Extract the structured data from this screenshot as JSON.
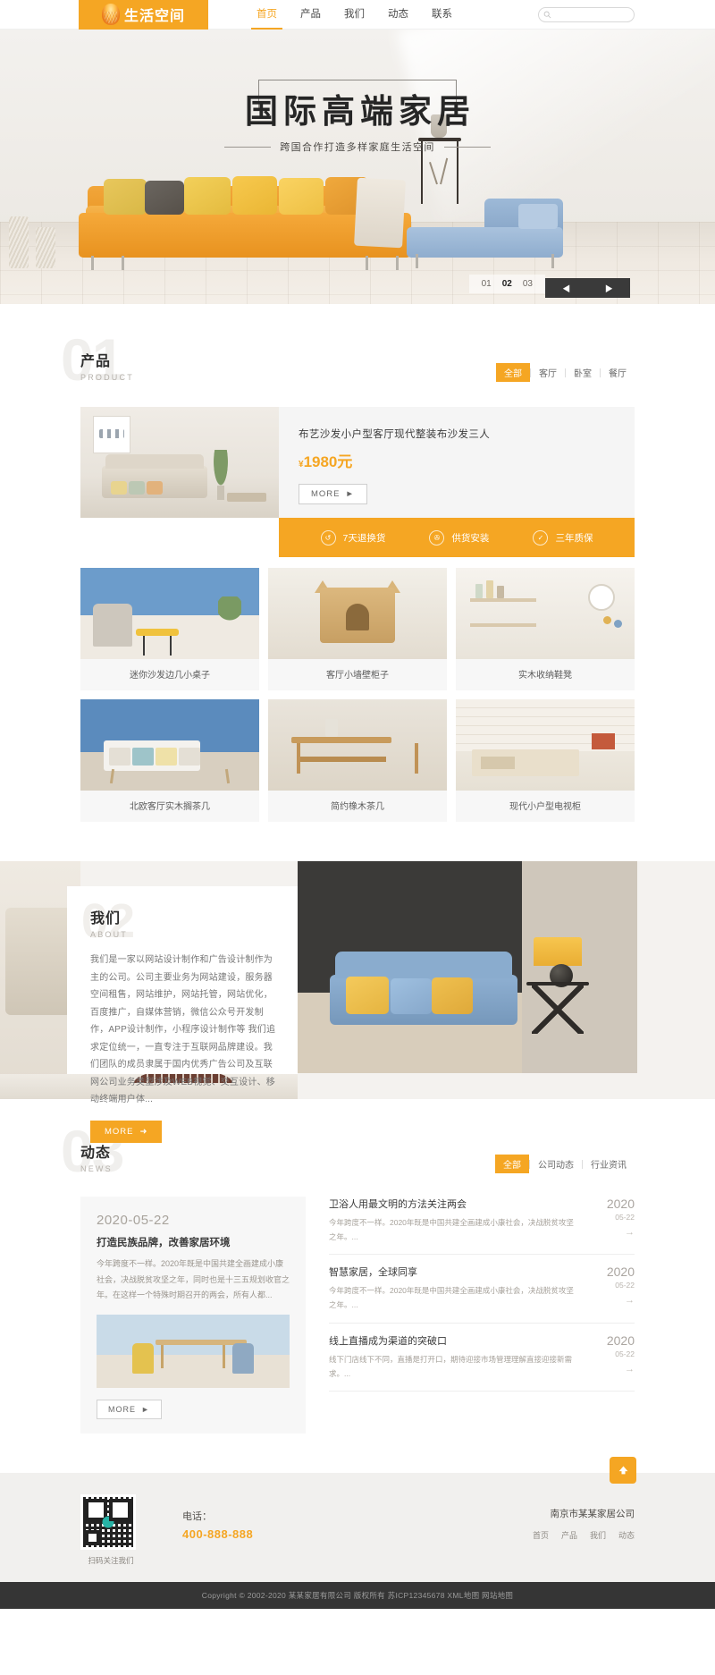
{
  "header": {
    "logo_text": "生活空间",
    "nav": [
      {
        "label": "首页",
        "active": true
      },
      {
        "label": "产品",
        "active": false
      },
      {
        "label": "我们",
        "active": false
      },
      {
        "label": "动态",
        "active": false
      },
      {
        "label": "联系",
        "active": false
      }
    ],
    "search_placeholder": ""
  },
  "hero": {
    "title": "国际高端家居",
    "subtitle": "跨国合作打造多样家庭生活空间",
    "slides": [
      "01",
      "02",
      "03"
    ],
    "active_slide": "02",
    "prev_label": "◀",
    "next_label": "▶"
  },
  "product": {
    "number": "01",
    "title_cn": "产品",
    "title_en": "PRODUCT",
    "filters": [
      {
        "label": "全部",
        "active": true
      },
      {
        "label": "客厅",
        "active": false
      },
      {
        "label": "卧室",
        "active": false
      },
      {
        "label": "餐厅",
        "active": false
      }
    ],
    "featured": {
      "title": "布艺沙发小户型客厅现代整装布沙发三人",
      "currency": "¥",
      "price": "1980元",
      "more_label": "MORE"
    },
    "services": [
      {
        "icon": "return-icon",
        "label": "7天退换货"
      },
      {
        "icon": "install-icon",
        "label": "供货安装"
      },
      {
        "icon": "warranty-icon",
        "label": "三年质保"
      }
    ],
    "items": [
      {
        "caption": "迷你沙发边几小桌子"
      },
      {
        "caption": "客厅小墙壁柜子"
      },
      {
        "caption": "实木收纳鞋凳"
      },
      {
        "caption": "北欧客厅实木搁茶几"
      },
      {
        "caption": "简约橡木茶几"
      },
      {
        "caption": "现代小户型电视柜"
      }
    ]
  },
  "about": {
    "number": "02",
    "title_cn": "我们",
    "title_en": "ABOUT",
    "text": "我们是一家以网站设计制作和广告设计制作为主的公司。公司主要业务为网站建设，服务器空间租售，网站维护，网站托管，网站优化，百度推广，自媒体营销，微信公众号开发制作，APP设计制作，小程序设计制作等 我们追求定位统一，一直专注于互联网品牌建设。我们团队的成员隶属于国内优秀广告公司及互联网公司业务类型涉及WEB视觉、交互设计、移动终端用户体...",
    "more_label": "MORE"
  },
  "news": {
    "number": "03",
    "title_cn": "动态",
    "title_en": "NEWS",
    "filters": [
      {
        "label": "全部",
        "active": true
      },
      {
        "label": "公司动态",
        "active": false
      },
      {
        "label": "行业资讯",
        "active": false
      }
    ],
    "feature": {
      "date": "2020-05-22",
      "title": "打造民族品牌，改善家居环境",
      "desc": "今年跨度不一样。2020年既是中国共建全画建成小康社会，决战脱贫攻坚之年，同时也是十三五规划收官之年。在这样一个特殊时期召开的两会，所有人都...",
      "more_label": "MORE"
    },
    "items": [
      {
        "title": "卫浴人用最文明的方法关注两会",
        "desc": "今年跨度不一样。2020年既是中国共建全画建成小康社会，决战脱贫攻坚之年。...",
        "year": "2020",
        "md": "05-22",
        "arrow": "→"
      },
      {
        "title": "智慧家居，全球同享",
        "desc": "今年跨度不一样。2020年既是中国共建全画建成小康社会，决战脱贫攻坚之年。...",
        "year": "2020",
        "md": "05-22",
        "arrow": "→"
      },
      {
        "title": "线上直播成为渠道的突破口",
        "desc": "线下门店线下不同，直播是打开口，期待迎接市场管理理解直接迎接新需求。...",
        "year": "2020",
        "md": "05-22",
        "arrow": "→"
      }
    ]
  },
  "footer": {
    "qr_caption": "扫码关注我们",
    "contact_label": "电话：",
    "phone": "400-888-888",
    "company": "南京市某某家居公司",
    "links": [
      {
        "label": "首页"
      },
      {
        "label": "产品"
      },
      {
        "label": "我们"
      },
      {
        "label": "动态"
      }
    ],
    "back_top_icon": "arrow-up-icon",
    "copyright": "Copyright © 2002-2020 某某家居有限公司 版权所有 苏ICP12345678 XML地图 网站地图"
  },
  "colors": {
    "accent": "#f5a623",
    "dark": "#353535",
    "text": "#333333"
  }
}
